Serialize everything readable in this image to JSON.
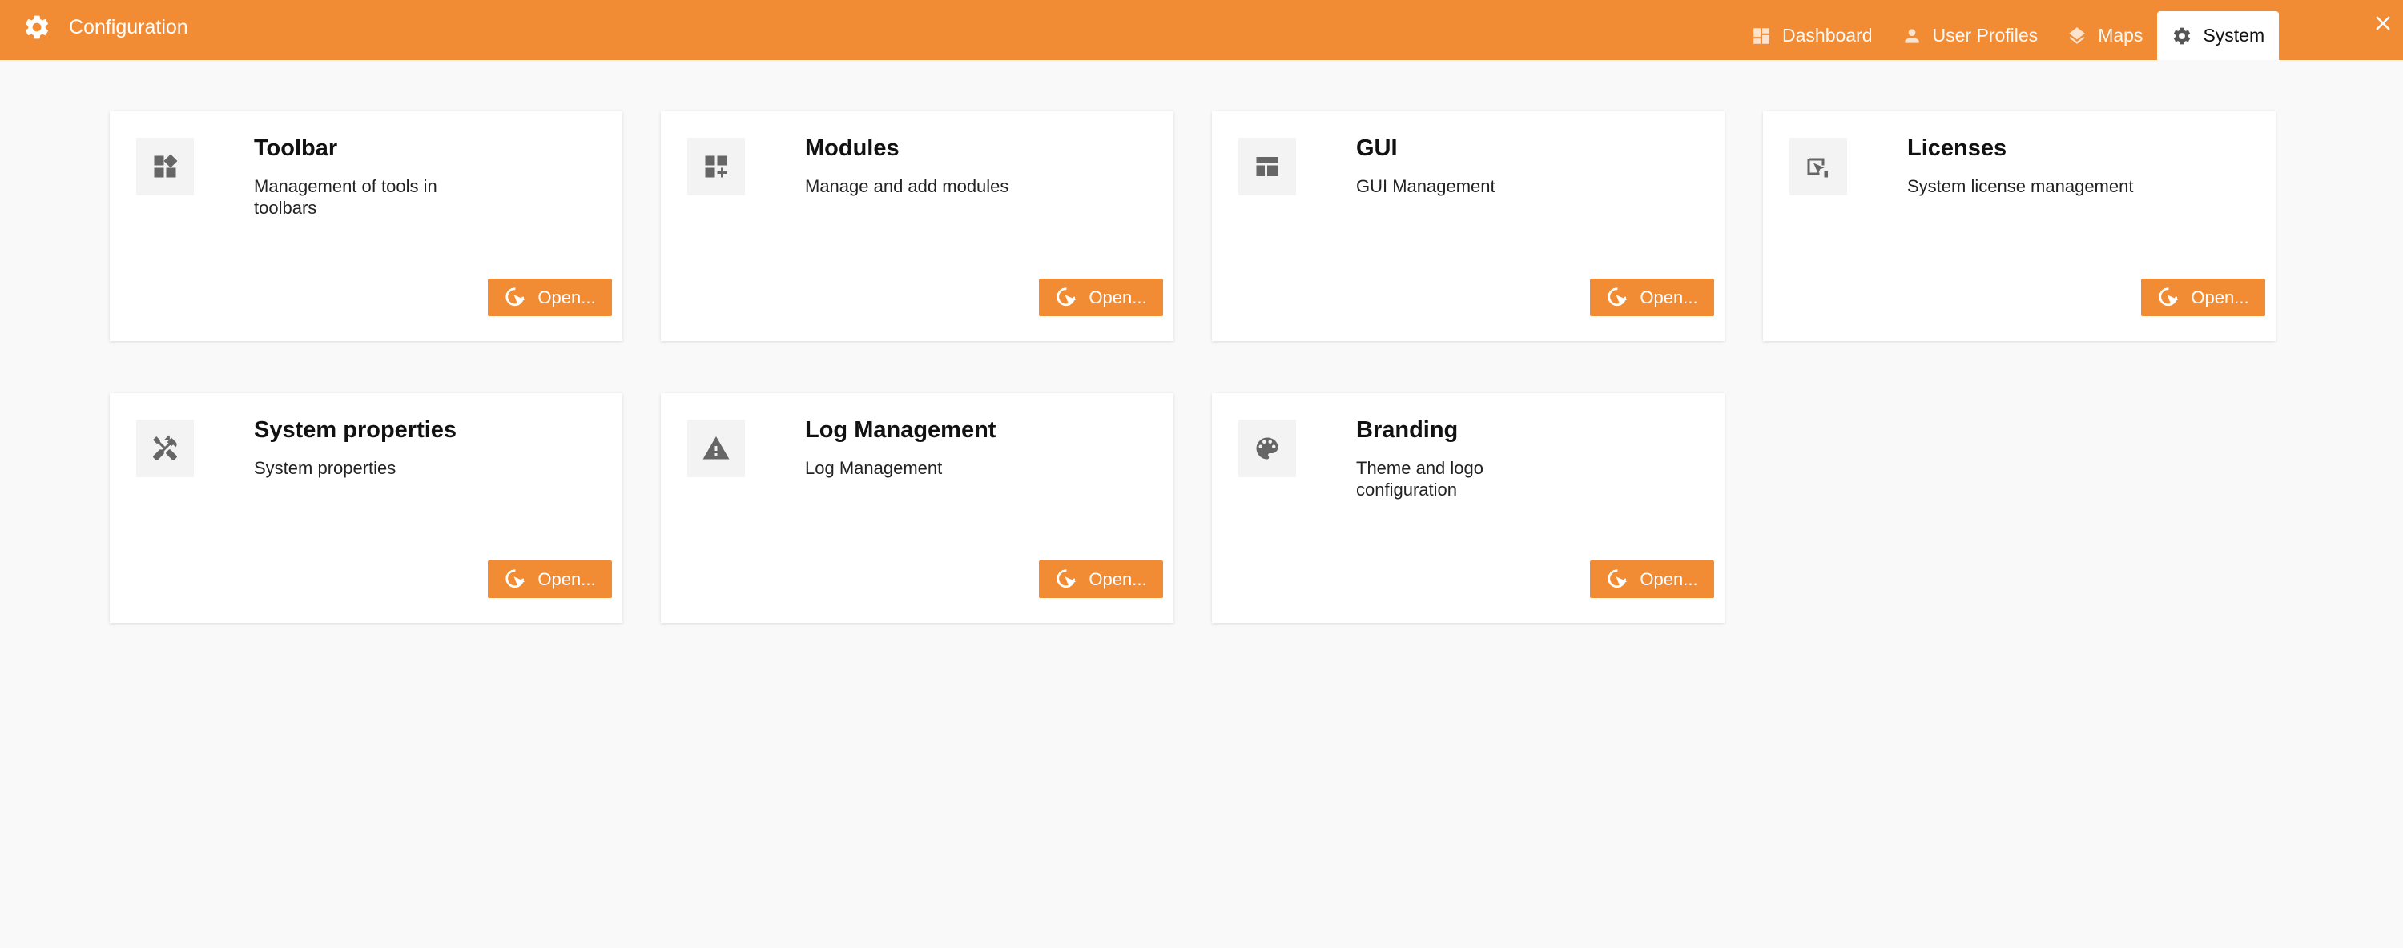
{
  "header": {
    "title": "Configuration",
    "icon": "gear-icon",
    "brand_color": "#f28c34",
    "tabs": [
      {
        "label": "Dashboard",
        "icon": "dashboard-icon",
        "active": false
      },
      {
        "label": "User Profiles",
        "icon": "user-icon",
        "active": false
      },
      {
        "label": "Maps",
        "icon": "layers-icon",
        "active": false
      },
      {
        "label": "System",
        "icon": "gear-icon",
        "active": true
      }
    ],
    "close_icon": "close-icon"
  },
  "cards": [
    {
      "title": "Toolbar",
      "description": "Management of tools in toolbars",
      "icon": "widgets-icon",
      "button_label": "Open..."
    },
    {
      "title": "Modules",
      "description": "Manage and add modules",
      "icon": "add-module-icon",
      "button_label": "Open..."
    },
    {
      "title": "GUI",
      "description": "GUI Management",
      "icon": "layout-icon",
      "button_label": "Open..."
    },
    {
      "title": "Licenses",
      "description": "System license management",
      "icon": "license-icon",
      "button_label": "Open..."
    },
    {
      "title": "System properties",
      "description": "System properties",
      "icon": "tools-icon",
      "button_label": "Open..."
    },
    {
      "title": "Log Management",
      "description": "Log Management",
      "icon": "warning-icon",
      "button_label": "Open..."
    },
    {
      "title": "Branding",
      "description": "Theme and logo configuration",
      "icon": "palette-icon",
      "button_label": "Open..."
    }
  ]
}
